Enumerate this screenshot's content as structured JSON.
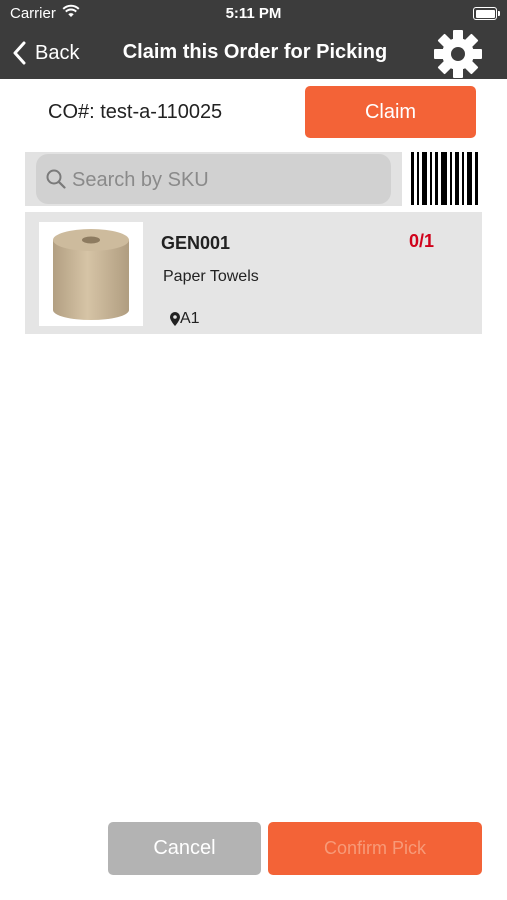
{
  "status_bar": {
    "carrier": "Carrier",
    "time": "5:11 PM"
  },
  "nav": {
    "back_label": "Back",
    "title": "Claim this Order for Picking"
  },
  "order": {
    "co_label": "CO#:",
    "co_number": "test-a-110025",
    "claim_label": "Claim"
  },
  "search": {
    "placeholder": "Search by SKU",
    "value": ""
  },
  "items": [
    {
      "sku": "GEN001",
      "name": "Paper Towels",
      "location": "A1",
      "picked": "0/1"
    }
  ],
  "footer": {
    "cancel_label": "Cancel",
    "confirm_label": "Confirm Pick"
  },
  "colors": {
    "accent": "#f36337",
    "header": "#3c3c3c",
    "qty": "#d0021b",
    "cancel": "#b3b3b3"
  }
}
